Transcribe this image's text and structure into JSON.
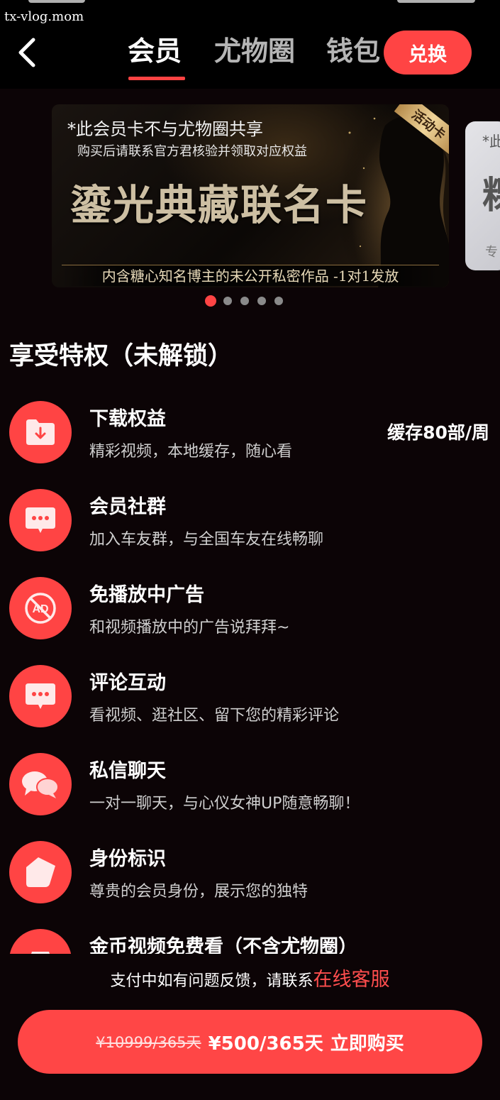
{
  "watermark": "tx-vlog.mom",
  "header": {
    "tabs": [
      "会员",
      "尤物圈",
      "钱包"
    ],
    "active_tab": 0,
    "redeem_label": "兑换"
  },
  "banner": {
    "corner_tag": "活动卡",
    "note": "*此会员卡不与尤物圈共享",
    "sub": "购买后请联系官方君核验并领取对应权益",
    "title": "鎏光典藏联名卡",
    "footer": "内含糖心知名博主的未公开私密作品 -1对1发放",
    "next_card": {
      "t1": "*此",
      "t2": "粿",
      "t3": "专"
    },
    "dots_total": 5,
    "dots_active": 0
  },
  "section_title": "享受特权（未解锁）",
  "privileges": [
    {
      "icon": "download-folder-icon",
      "title": "下载权益",
      "desc": "精彩视频，本地缓存，随心看",
      "extra": "缓存80部/周"
    },
    {
      "icon": "chat-bubble-icon",
      "title": "会员社群",
      "desc": "加入车友群，与全国车友在线畅聊",
      "extra": ""
    },
    {
      "icon": "no-ads-icon",
      "title": "免播放中广告",
      "desc": "和视频播放中的广告说拜拜~",
      "extra": ""
    },
    {
      "icon": "comment-icon",
      "title": "评论互动",
      "desc": "看视频、逛社区、留下您的精彩评论",
      "extra": ""
    },
    {
      "icon": "private-message-icon",
      "title": "私信聊天",
      "desc": "一对一聊天，与心仪女神UP随意畅聊！",
      "extra": ""
    },
    {
      "icon": "identity-badge-icon",
      "title": "身份标识",
      "desc": "尊贵的会员身份，展示您的独特",
      "extra": ""
    },
    {
      "icon": "coin-video-icon",
      "title": "金币视频免费看（不含尤物圈）",
      "desc": "",
      "extra": ""
    }
  ],
  "footer": {
    "note": "支付中如有问题反馈，请联系",
    "link": "在线客服"
  },
  "buy": {
    "original_price": "¥10999/365天",
    "price": "¥500/365天",
    "action": "立即购买"
  },
  "colors": {
    "accent": "#ff4444",
    "background": "#0c0406"
  }
}
